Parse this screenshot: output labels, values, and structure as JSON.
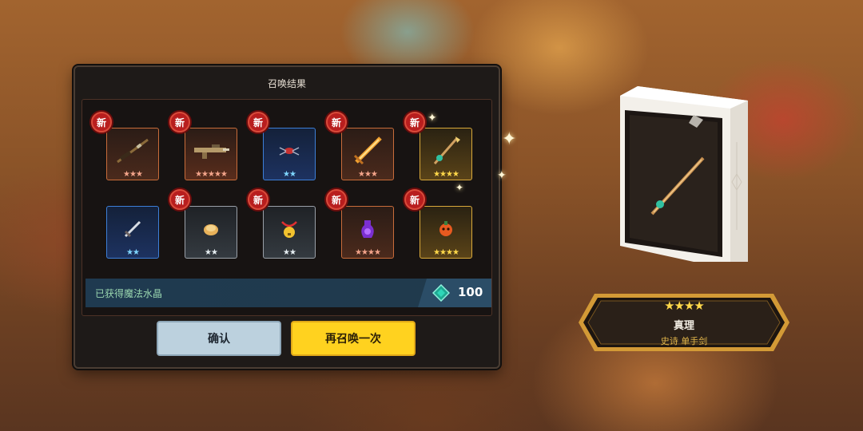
{
  "dialog": {
    "title": "召唤结果",
    "new_badge": "新",
    "items_row1": [
      {
        "name": "rifle",
        "rarity_color": "#c86c3a",
        "stars": "★★★",
        "star_color": "#f3a48a",
        "is_new": true
      },
      {
        "name": "machine-gun",
        "rarity_color": "#c86c3a",
        "stars": "★★★★★",
        "star_color": "#f3a48a",
        "is_new": true
      },
      {
        "name": "spider-pet",
        "rarity_color": "#3d7fd8",
        "stars": "★★",
        "star_color": "#7fd6ff",
        "is_new": true
      },
      {
        "name": "flame-sword",
        "rarity_color": "#c86c3a",
        "stars": "★★★",
        "star_color": "#f3a48a",
        "is_new": true
      },
      {
        "name": "truth-staff",
        "rarity_color": "#d9a93a",
        "stars": "★★★★",
        "star_color": "#ffd84a",
        "is_new": true
      }
    ],
    "items_row2": [
      {
        "name": "dagger",
        "rarity_color": "#3d7fd8",
        "stars": "★★",
        "star_color": "#7fd6ff",
        "is_new": false
      },
      {
        "name": "bread",
        "rarity_color": "#9aa0a8",
        "stars": "★★",
        "star_color": "#e6eef2",
        "is_new": true
      },
      {
        "name": "bell-necklace",
        "rarity_color": "#9aa0a8",
        "stars": "★★",
        "star_color": "#e6eef2",
        "is_new": true
      },
      {
        "name": "dark-potion",
        "rarity_color": "#c86c3a",
        "stars": "★★★★",
        "star_color": "#f3a48a",
        "is_new": true
      },
      {
        "name": "pumpkin-trinket",
        "rarity_color": "#d9a93a",
        "stars": "★★★★",
        "star_color": "#ffd84a",
        "is_new": true
      }
    ],
    "crystal_label": "已获得魔法水晶",
    "crystal_count": "100",
    "confirm_button": "确认",
    "summon_again_button": "再召唤一次"
  },
  "featured": {
    "stars": "★★★★",
    "name": "真理",
    "subtitle": "史诗  单手剑"
  }
}
